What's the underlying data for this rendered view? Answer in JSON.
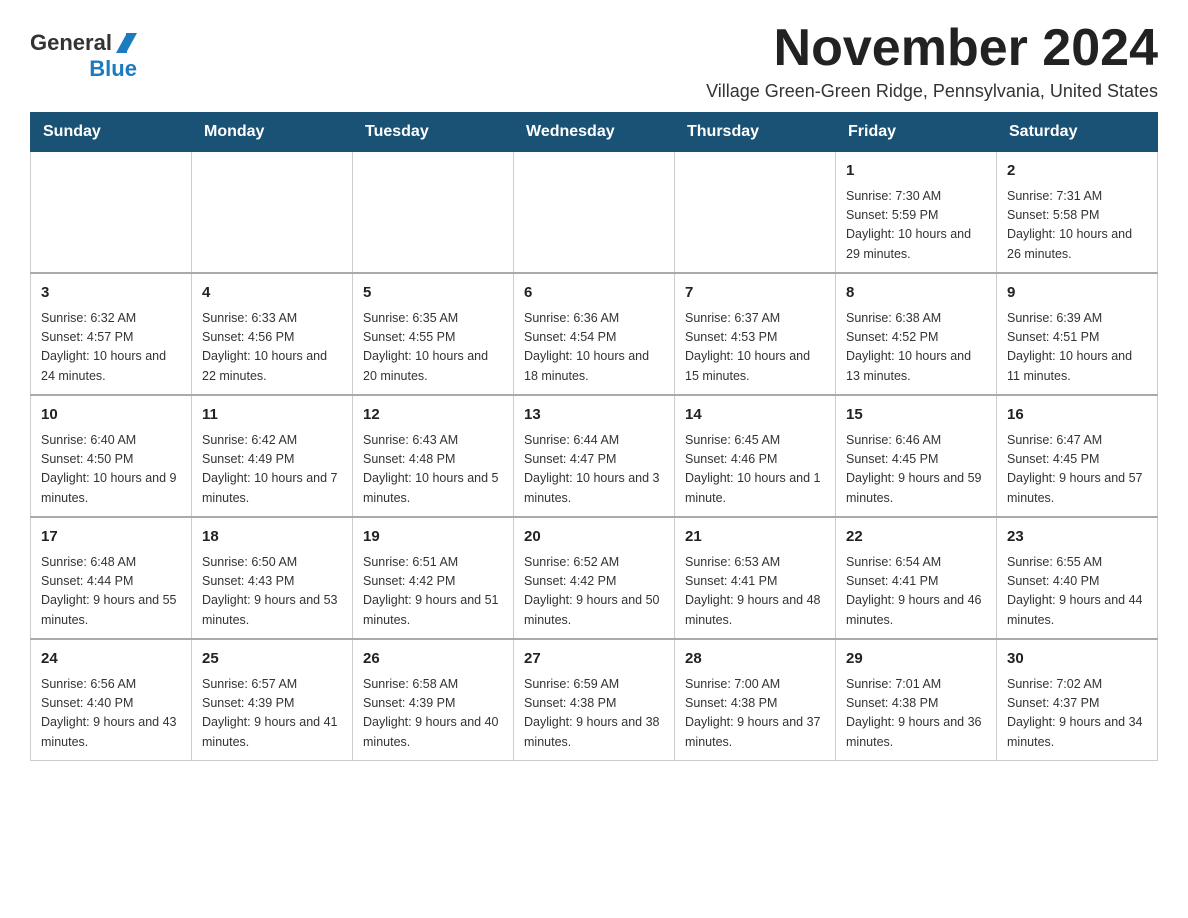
{
  "header": {
    "logo_line1": "General",
    "logo_line2": "Blue",
    "month_title": "November 2024",
    "location": "Village Green-Green Ridge, Pennsylvania, United States"
  },
  "calendar": {
    "headers": [
      "Sunday",
      "Monday",
      "Tuesday",
      "Wednesday",
      "Thursday",
      "Friday",
      "Saturday"
    ],
    "rows": [
      [
        {
          "day": "",
          "info": ""
        },
        {
          "day": "",
          "info": ""
        },
        {
          "day": "",
          "info": ""
        },
        {
          "day": "",
          "info": ""
        },
        {
          "day": "",
          "info": ""
        },
        {
          "day": "1",
          "info": "Sunrise: 7:30 AM\nSunset: 5:59 PM\nDaylight: 10 hours and 29 minutes."
        },
        {
          "day": "2",
          "info": "Sunrise: 7:31 AM\nSunset: 5:58 PM\nDaylight: 10 hours and 26 minutes."
        }
      ],
      [
        {
          "day": "3",
          "info": "Sunrise: 6:32 AM\nSunset: 4:57 PM\nDaylight: 10 hours and 24 minutes."
        },
        {
          "day": "4",
          "info": "Sunrise: 6:33 AM\nSunset: 4:56 PM\nDaylight: 10 hours and 22 minutes."
        },
        {
          "day": "5",
          "info": "Sunrise: 6:35 AM\nSunset: 4:55 PM\nDaylight: 10 hours and 20 minutes."
        },
        {
          "day": "6",
          "info": "Sunrise: 6:36 AM\nSunset: 4:54 PM\nDaylight: 10 hours and 18 minutes."
        },
        {
          "day": "7",
          "info": "Sunrise: 6:37 AM\nSunset: 4:53 PM\nDaylight: 10 hours and 15 minutes."
        },
        {
          "day": "8",
          "info": "Sunrise: 6:38 AM\nSunset: 4:52 PM\nDaylight: 10 hours and 13 minutes."
        },
        {
          "day": "9",
          "info": "Sunrise: 6:39 AM\nSunset: 4:51 PM\nDaylight: 10 hours and 11 minutes."
        }
      ],
      [
        {
          "day": "10",
          "info": "Sunrise: 6:40 AM\nSunset: 4:50 PM\nDaylight: 10 hours and 9 minutes."
        },
        {
          "day": "11",
          "info": "Sunrise: 6:42 AM\nSunset: 4:49 PM\nDaylight: 10 hours and 7 minutes."
        },
        {
          "day": "12",
          "info": "Sunrise: 6:43 AM\nSunset: 4:48 PM\nDaylight: 10 hours and 5 minutes."
        },
        {
          "day": "13",
          "info": "Sunrise: 6:44 AM\nSunset: 4:47 PM\nDaylight: 10 hours and 3 minutes."
        },
        {
          "day": "14",
          "info": "Sunrise: 6:45 AM\nSunset: 4:46 PM\nDaylight: 10 hours and 1 minute."
        },
        {
          "day": "15",
          "info": "Sunrise: 6:46 AM\nSunset: 4:45 PM\nDaylight: 9 hours and 59 minutes."
        },
        {
          "day": "16",
          "info": "Sunrise: 6:47 AM\nSunset: 4:45 PM\nDaylight: 9 hours and 57 minutes."
        }
      ],
      [
        {
          "day": "17",
          "info": "Sunrise: 6:48 AM\nSunset: 4:44 PM\nDaylight: 9 hours and 55 minutes."
        },
        {
          "day": "18",
          "info": "Sunrise: 6:50 AM\nSunset: 4:43 PM\nDaylight: 9 hours and 53 minutes."
        },
        {
          "day": "19",
          "info": "Sunrise: 6:51 AM\nSunset: 4:42 PM\nDaylight: 9 hours and 51 minutes."
        },
        {
          "day": "20",
          "info": "Sunrise: 6:52 AM\nSunset: 4:42 PM\nDaylight: 9 hours and 50 minutes."
        },
        {
          "day": "21",
          "info": "Sunrise: 6:53 AM\nSunset: 4:41 PM\nDaylight: 9 hours and 48 minutes."
        },
        {
          "day": "22",
          "info": "Sunrise: 6:54 AM\nSunset: 4:41 PM\nDaylight: 9 hours and 46 minutes."
        },
        {
          "day": "23",
          "info": "Sunrise: 6:55 AM\nSunset: 4:40 PM\nDaylight: 9 hours and 44 minutes."
        }
      ],
      [
        {
          "day": "24",
          "info": "Sunrise: 6:56 AM\nSunset: 4:40 PM\nDaylight: 9 hours and 43 minutes."
        },
        {
          "day": "25",
          "info": "Sunrise: 6:57 AM\nSunset: 4:39 PM\nDaylight: 9 hours and 41 minutes."
        },
        {
          "day": "26",
          "info": "Sunrise: 6:58 AM\nSunset: 4:39 PM\nDaylight: 9 hours and 40 minutes."
        },
        {
          "day": "27",
          "info": "Sunrise: 6:59 AM\nSunset: 4:38 PM\nDaylight: 9 hours and 38 minutes."
        },
        {
          "day": "28",
          "info": "Sunrise: 7:00 AM\nSunset: 4:38 PM\nDaylight: 9 hours and 37 minutes."
        },
        {
          "day": "29",
          "info": "Sunrise: 7:01 AM\nSunset: 4:38 PM\nDaylight: 9 hours and 36 minutes."
        },
        {
          "day": "30",
          "info": "Sunrise: 7:02 AM\nSunset: 4:37 PM\nDaylight: 9 hours and 34 minutes."
        }
      ]
    ]
  }
}
